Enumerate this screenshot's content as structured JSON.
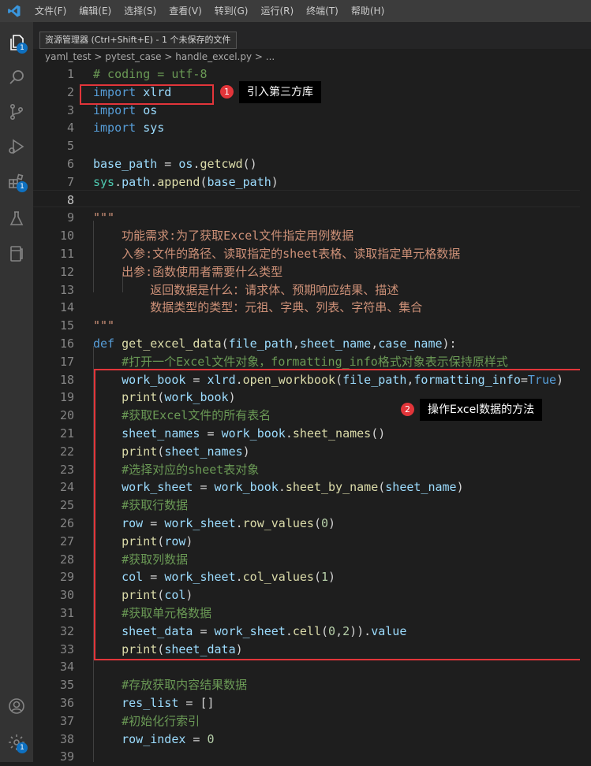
{
  "menu": [
    "文件(F)",
    "编辑(E)",
    "选择(S)",
    "查看(V)",
    "转到(G)",
    "运行(R)",
    "终端(T)",
    "帮助(H)"
  ],
  "tooltip": "资源管理器 (Ctrl+Shift+E) - 1 个未保存的文件",
  "breadcrumb": {
    "folder1": "yaml_test",
    "folder2": "pytest_case",
    "file": "handle_excel.py",
    "more": "..."
  },
  "activity_badges": {
    "explorer": "1",
    "extensions": "1",
    "settings": "1"
  },
  "annotations": {
    "marker1": "1",
    "callout1": "引入第三方库",
    "marker2": "2",
    "callout2": "操作Excel数据的方法"
  },
  "lines": [
    {
      "n": "1",
      "tokens": [
        [
          "cmt",
          "# coding = utf-8"
        ]
      ]
    },
    {
      "n": "2",
      "tokens": [
        [
          "kw",
          "import"
        ],
        [
          "",
          "  "
        ],
        [
          "var",
          "xlrd"
        ]
      ]
    },
    {
      "n": "3",
      "tokens": [
        [
          "kw",
          "import"
        ],
        [
          "",
          ""
        ],
        [
          "var",
          "os"
        ]
      ]
    },
    {
      "n": "4",
      "tokens": [
        [
          "kw",
          "import"
        ],
        [
          "",
          ""
        ],
        [
          "var",
          "sys"
        ]
      ]
    },
    {
      "n": "5",
      "tokens": []
    },
    {
      "n": "6",
      "tokens": [
        [
          "var",
          "base_path"
        ],
        [
          "",
          " = "
        ],
        [
          "var",
          "os"
        ],
        [
          "",
          "."
        ],
        [
          "fn",
          "getcwd"
        ],
        [
          "",
          "()"
        ]
      ]
    },
    {
      "n": "7",
      "tokens": [
        [
          "cls",
          "sys"
        ],
        [
          "",
          "."
        ],
        [
          "var",
          "path"
        ],
        [
          "",
          "."
        ],
        [
          "fn",
          "append"
        ],
        [
          "",
          "("
        ],
        [
          "var",
          "base_path"
        ],
        [
          "",
          ")"
        ]
      ]
    },
    {
      "n": "8",
      "tokens": []
    },
    {
      "n": "9",
      "tokens": [
        [
          "str",
          "\"\"\""
        ]
      ]
    },
    {
      "n": "10",
      "tokens": [
        [
          "str",
          "    功能需求:为了获取Excel文件指定用例数据"
        ]
      ]
    },
    {
      "n": "11",
      "tokens": [
        [
          "str",
          "    入参:文件的路径、读取指定的sheet表格、读取指定单元格数据"
        ]
      ]
    },
    {
      "n": "12",
      "tokens": [
        [
          "str",
          "    出参:函数使用者需要什么类型"
        ]
      ]
    },
    {
      "n": "13",
      "tokens": [
        [
          "str",
          "        返回数据是什么：请求体、预期响应结果、描述"
        ]
      ]
    },
    {
      "n": "14",
      "tokens": [
        [
          "str",
          "        数据类型的类型：元祖、字典、列表、字符串、集合"
        ]
      ]
    },
    {
      "n": "15",
      "tokens": [
        [
          "str",
          "\"\"\""
        ]
      ]
    },
    {
      "n": "16",
      "tokens": [
        [
          "kw",
          "def"
        ],
        [
          "",
          " "
        ],
        [
          "fn",
          "get_excel_data"
        ],
        [
          "",
          "("
        ],
        [
          "var",
          "file_path"
        ],
        [
          "",
          ","
        ],
        [
          "var",
          "sheet_name"
        ],
        [
          "",
          ","
        ],
        [
          "var",
          "case_name"
        ],
        [
          "",
          "):"
        ]
      ]
    },
    {
      "n": "17",
      "tokens": [
        [
          "",
          "    "
        ],
        [
          "cmt",
          "#打开一个Excel文件对象，formatting_info格式对象表示保持原样式"
        ]
      ]
    },
    {
      "n": "18",
      "tokens": [
        [
          "",
          "    "
        ],
        [
          "var",
          "work_book"
        ],
        [
          "",
          " = "
        ],
        [
          "var",
          "xlrd"
        ],
        [
          "",
          "."
        ],
        [
          "fn",
          "open_workbook"
        ],
        [
          "",
          "("
        ],
        [
          "var",
          "file_path"
        ],
        [
          "",
          ","
        ],
        [
          "var",
          "formatting_info"
        ],
        [
          "",
          "="
        ],
        [
          "kw",
          "True"
        ],
        [
          "",
          ")"
        ]
      ]
    },
    {
      "n": "19",
      "tokens": [
        [
          "",
          "    "
        ],
        [
          "fn",
          "print"
        ],
        [
          "",
          "("
        ],
        [
          "var",
          "work_book"
        ],
        [
          "",
          ")"
        ]
      ]
    },
    {
      "n": "20",
      "tokens": [
        [
          "",
          "    "
        ],
        [
          "cmt",
          "#获取Excel文件的所有表名"
        ]
      ]
    },
    {
      "n": "21",
      "tokens": [
        [
          "",
          "    "
        ],
        [
          "var",
          "sheet_names"
        ],
        [
          "",
          " = "
        ],
        [
          "var",
          "work_book"
        ],
        [
          "",
          "."
        ],
        [
          "fn",
          "sheet_names"
        ],
        [
          "",
          "()"
        ]
      ]
    },
    {
      "n": "22",
      "tokens": [
        [
          "",
          "    "
        ],
        [
          "fn",
          "print"
        ],
        [
          "",
          "("
        ],
        [
          "var",
          "sheet_names"
        ],
        [
          "",
          ")"
        ]
      ]
    },
    {
      "n": "23",
      "tokens": [
        [
          "",
          "    "
        ],
        [
          "cmt",
          "#选择对应的sheet表对象"
        ]
      ]
    },
    {
      "n": "24",
      "tokens": [
        [
          "",
          "    "
        ],
        [
          "var",
          "work_sheet"
        ],
        [
          "",
          " = "
        ],
        [
          "var",
          "work_book"
        ],
        [
          "",
          "."
        ],
        [
          "fn",
          "sheet_by_name"
        ],
        [
          "",
          "("
        ],
        [
          "var",
          "sheet_name"
        ],
        [
          "",
          ")"
        ]
      ]
    },
    {
      "n": "25",
      "tokens": [
        [
          "",
          "    "
        ],
        [
          "cmt",
          "#获取行数据"
        ]
      ]
    },
    {
      "n": "26",
      "tokens": [
        [
          "",
          "    "
        ],
        [
          "var",
          "row"
        ],
        [
          "",
          " = "
        ],
        [
          "var",
          "work_sheet"
        ],
        [
          "",
          "."
        ],
        [
          "fn",
          "row_values"
        ],
        [
          "",
          "("
        ],
        [
          "num",
          "0"
        ],
        [
          "",
          ")"
        ]
      ]
    },
    {
      "n": "27",
      "tokens": [
        [
          "",
          "    "
        ],
        [
          "fn",
          "print"
        ],
        [
          "",
          "("
        ],
        [
          "var",
          "row"
        ],
        [
          "",
          ")"
        ]
      ]
    },
    {
      "n": "28",
      "tokens": [
        [
          "",
          "    "
        ],
        [
          "cmt",
          "#获取列数据"
        ]
      ]
    },
    {
      "n": "29",
      "tokens": [
        [
          "",
          "    "
        ],
        [
          "var",
          "col"
        ],
        [
          "",
          " = "
        ],
        [
          "var",
          "work_sheet"
        ],
        [
          "",
          "."
        ],
        [
          "fn",
          "col_values"
        ],
        [
          "",
          "("
        ],
        [
          "num",
          "1"
        ],
        [
          "",
          ")"
        ]
      ]
    },
    {
      "n": "30",
      "tokens": [
        [
          "",
          "    "
        ],
        [
          "fn",
          "print"
        ],
        [
          "",
          "("
        ],
        [
          "var",
          "col"
        ],
        [
          "",
          ")"
        ]
      ]
    },
    {
      "n": "31",
      "tokens": [
        [
          "",
          "    "
        ],
        [
          "cmt",
          "#获取单元格数据"
        ]
      ]
    },
    {
      "n": "32",
      "tokens": [
        [
          "",
          "    "
        ],
        [
          "var",
          "sheet_data"
        ],
        [
          "",
          " = "
        ],
        [
          "var",
          "work_sheet"
        ],
        [
          "",
          "."
        ],
        [
          "fn",
          "cell"
        ],
        [
          "",
          "("
        ],
        [
          "num",
          "0"
        ],
        [
          "",
          ","
        ],
        [
          "num",
          "2"
        ],
        [
          "",
          "))."
        ],
        [
          "var",
          "value"
        ]
      ]
    },
    {
      "n": "33",
      "tokens": [
        [
          "",
          "    "
        ],
        [
          "fn",
          "print"
        ],
        [
          "",
          "("
        ],
        [
          "var",
          "sheet_data"
        ],
        [
          "",
          ")"
        ]
      ]
    },
    {
      "n": "34",
      "tokens": []
    },
    {
      "n": "35",
      "tokens": [
        [
          "",
          "    "
        ],
        [
          "cmt",
          "#存放获取内容结果数据"
        ]
      ]
    },
    {
      "n": "36",
      "tokens": [
        [
          "",
          "    "
        ],
        [
          "var",
          "res_list"
        ],
        [
          "",
          " = "
        ],
        [
          "",
          "[]"
        ]
      ]
    },
    {
      "n": "37",
      "tokens": [
        [
          "",
          "    "
        ],
        [
          "cmt",
          "#初始化行索引"
        ]
      ]
    },
    {
      "n": "38",
      "tokens": [
        [
          "",
          "    "
        ],
        [
          "var",
          "row_index"
        ],
        [
          "",
          " = "
        ],
        [
          "num",
          "0"
        ]
      ]
    },
    {
      "n": "39",
      "tokens": []
    }
  ],
  "active_line": "8"
}
